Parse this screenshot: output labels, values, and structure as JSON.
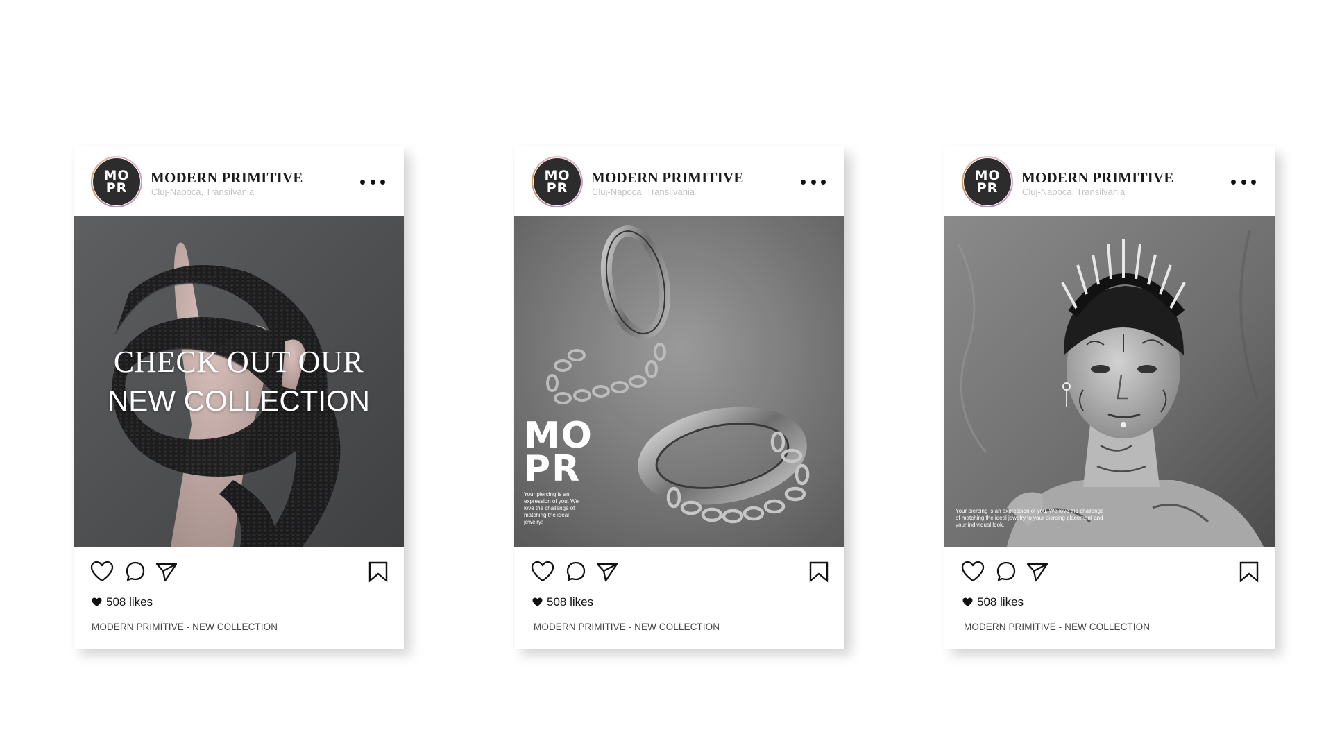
{
  "account": {
    "name": "MODERN PRIMITIVE",
    "location": "Cluj-Napoca, Transilvania",
    "logo_top": "MO",
    "logo_bottom": "PR"
  },
  "icons": {
    "like": "heart-outline-icon",
    "comment": "comment-bubble-icon",
    "share": "paper-plane-icon",
    "save": "bookmark-icon",
    "more": "more-dots-icon",
    "likes_heart": "heart-filled-icon"
  },
  "posts": [
    {
      "overlay_line1": "CHECK OUT OUR",
      "overlay_line2": "NEW COLLECTION",
      "likes": "508 likes",
      "caption": "MODERN PRIMITIVE - NEW COLLECTION"
    },
    {
      "brand_top": "MO",
      "brand_bottom": "PR",
      "tagline": "Your piercing is an expression of you. We love the challenge of matching the ideal jewelry!",
      "likes": "508 likes",
      "caption": "MODERN PRIMITIVE - NEW COLLECTION"
    },
    {
      "tagline": "Your piercing is an expression of you. We love the challenge of matching the ideal jewelry to your piercing placement and your individual look.",
      "likes": "508 likes",
      "caption": "MODERN PRIMITIVE - NEW COLLECTION"
    }
  ],
  "colors": {
    "avatar_bg": "#2d2c2c",
    "ring_pink": "#f2b6c4",
    "ring_orange": "#d69c5a",
    "location_gray": "#c3c3c3"
  }
}
